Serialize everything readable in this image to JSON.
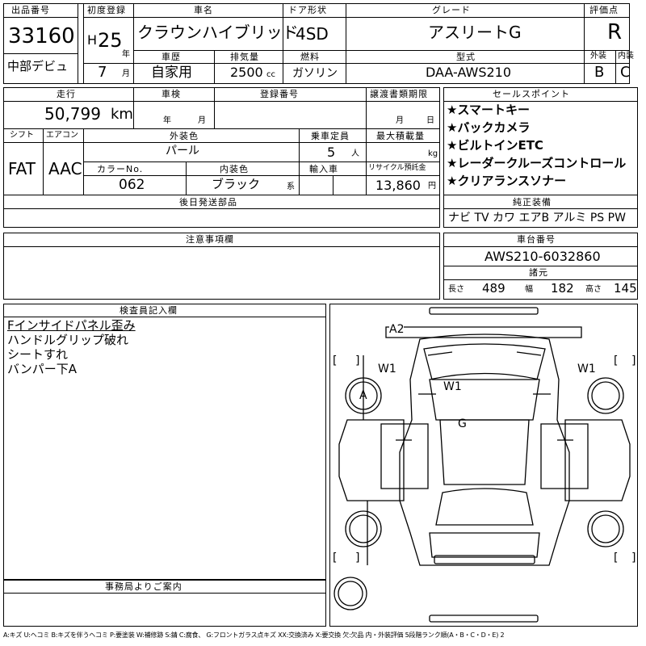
{
  "header": {
    "lot_label": "出品番号",
    "lot_no": "33160",
    "debut": "中部デビュ",
    "first_reg_label": "初度登録",
    "era": "H",
    "year": "25",
    "year_unit": "年",
    "month": "7",
    "month_unit": "月",
    "model_label": "車名",
    "model": "クラウンハイブリッド",
    "history_label": "車歴",
    "history": "自家用",
    "displacement_label": "排気量",
    "displacement": "2500",
    "cc": "cc",
    "door_label": "ドア形状",
    "door": "4SD",
    "fuel_label": "燃料",
    "fuel": "ガソリン",
    "grade_label": "グレード",
    "grade": "アスリートG",
    "type_label": "型式",
    "type": "DAA-AWS210",
    "score_label": "評価点",
    "score": "R",
    "ext_label": "外装",
    "ext": "B",
    "int_label": "内装",
    "int": "C"
  },
  "info": {
    "mileage_label": "走行",
    "mileage": "50,799",
    "km": "km",
    "inspection_label": "車検",
    "insp_year_unit": "年",
    "insp_month_unit": "月",
    "plate_label": "登録番号",
    "transfer_label": "譲渡書類期限",
    "transfer_month_unit": "月",
    "transfer_day_unit": "日",
    "shift_label": "シフト",
    "shift": "FAT",
    "ac_label": "エアコン",
    "ac": "AAC",
    "exterior_color_label": "外装色",
    "exterior_color": "パール",
    "capacity_label": "乗車定員",
    "capacity": "5",
    "capacity_unit": "人",
    "load_label": "最大積載量",
    "load_unit": "kg",
    "color_no_label": "カラーNo.",
    "color_no": "062",
    "interior_color_label": "内装色",
    "interior_color": "ブラック",
    "interior_color_suffix": "系",
    "import_label": "輸入車",
    "recycle_label": "リサイクル預託金",
    "recycle": "13,860",
    "yen": "円",
    "later_parts_label": "後日発送部品"
  },
  "selling_points": {
    "label": "セールスポイント",
    "items": [
      "★スマートキー",
      "★バックカメラ",
      "★ビルトインETC",
      "★レーダークルーズコントロール",
      "★クリアランスソナー"
    ]
  },
  "equipment": {
    "label": "純正装備",
    "value": "ナビ TV カワ エアB アルミ PS PW"
  },
  "notes": {
    "label": "注意事項欄"
  },
  "chassis": {
    "label": "車台番号",
    "value": "AWS210-6032860"
  },
  "dimensions": {
    "label": "諸元",
    "length_label": "長さ",
    "length": "489",
    "width_label": "幅",
    "width": "182",
    "height_label": "高さ",
    "height": "145"
  },
  "inspector": {
    "label": "検査員記入欄",
    "lines": [
      "Fインサイドパネル歪み",
      "ハンドルグリップ破れ",
      "シートすれ",
      "バンパー下A"
    ]
  },
  "office": {
    "label": "事務局よりご案内"
  },
  "diagram": {
    "marks": {
      "a2": "A2",
      "w1_left": "W1",
      "w1_right": "W1",
      "w1_center": "W1",
      "a": "A",
      "g": "G"
    },
    "bracket_open": "[",
    "bracket_close": "]"
  },
  "legend": "A:キズ U:ヘコミ B:キズを伴うヘコミ P:要塗装 W:補修跡 S:錆 C:腐食、 G:フロントガラス点キズ XX:交換済み X:要交換 欠:欠品 内・外装評価 5段階ランク順(A・B・C・D・E) 2"
}
